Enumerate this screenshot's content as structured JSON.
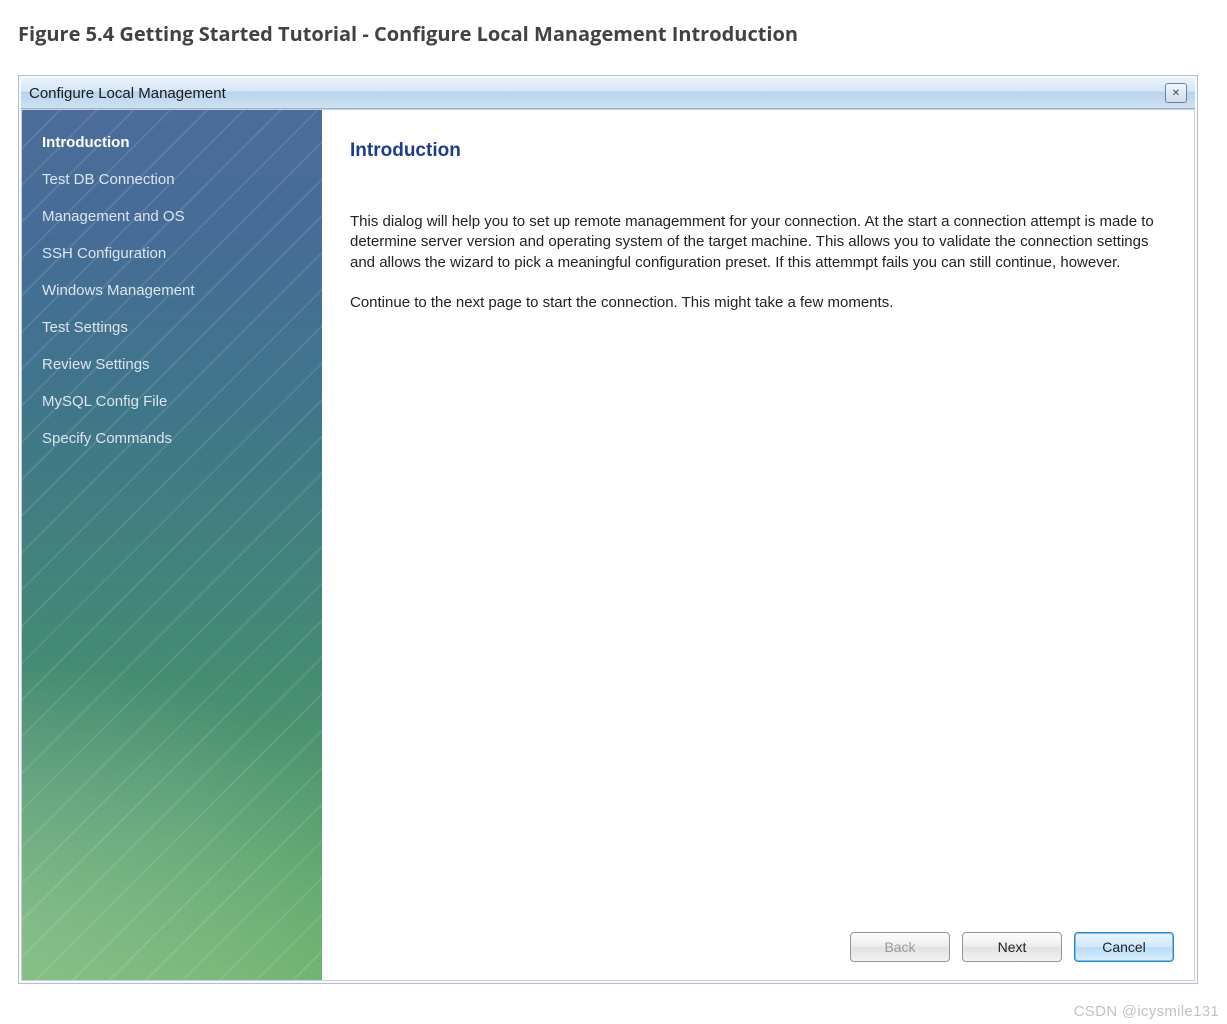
{
  "figure_caption": "Figure 5.4 Getting Started Tutorial - Configure Local Management Introduction",
  "window": {
    "title": "Configure Local Management"
  },
  "sidebar": {
    "items": [
      {
        "label": "Introduction",
        "active": true
      },
      {
        "label": "Test DB Connection",
        "active": false
      },
      {
        "label": "Management and OS",
        "active": false
      },
      {
        "label": "SSH Configuration",
        "active": false
      },
      {
        "label": "Windows Management",
        "active": false
      },
      {
        "label": "Test Settings",
        "active": false
      },
      {
        "label": "Review Settings",
        "active": false
      },
      {
        "label": "MySQL Config File",
        "active": false
      },
      {
        "label": "Specify Commands",
        "active": false
      }
    ]
  },
  "content": {
    "heading": "Introduction",
    "para1": "This dialog will help you to set up remote managemment for your connection. At the start a connection attempt is made to determine server version and operating system of the target machine. This allows you to validate the connection settings and allows the wizard to pick a meaningful configuration preset. If this attemmpt fails you can still continue, however.",
    "para2": "Continue to the next page to start the connection. This might take a few moments."
  },
  "buttons": {
    "back": "Back",
    "next": "Next",
    "cancel": "Cancel"
  },
  "watermark": "CSDN @icysmile131"
}
